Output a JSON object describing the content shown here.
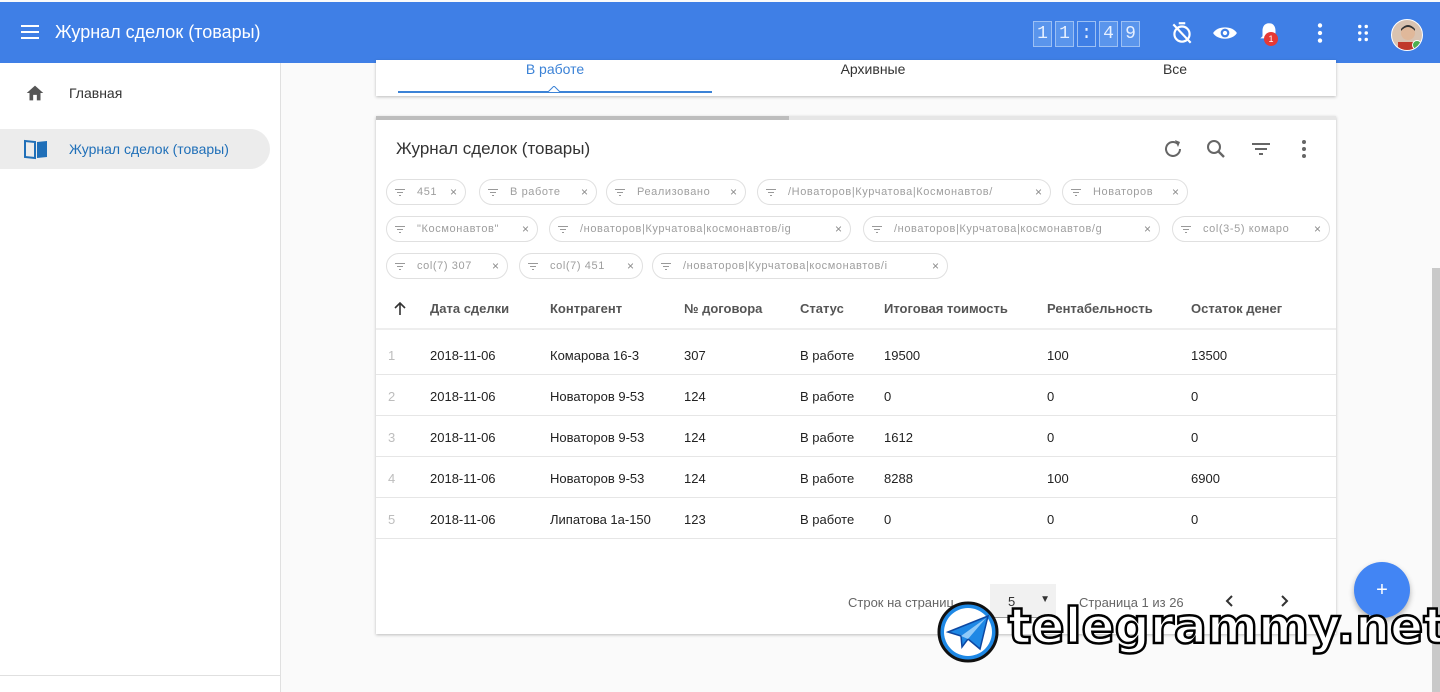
{
  "app": {
    "title": "Журнал сделок (товары)",
    "clock": [
      "1",
      "1",
      ":",
      "4",
      "9"
    ],
    "notifications_count": "1",
    "icons": [
      "menu-icon",
      "timer-off-icon",
      "eye-icon",
      "bell-icon",
      "more-vert-icon",
      "apps-icon"
    ]
  },
  "sidebar": {
    "items": [
      {
        "label": "Главная",
        "icon": "home-icon"
      },
      {
        "label": "Журнал сделок (товары)",
        "icon": "book-icon"
      }
    ]
  },
  "tabs": [
    {
      "label": "В работе"
    },
    {
      "label": "Архивные"
    },
    {
      "label": "Все"
    }
  ],
  "table_card": {
    "title": "Журнал сделок (товары)",
    "progress": 0.43,
    "chips": [
      "451",
      "В работе",
      "Реализовано",
      "/Новаторов|Курчатова|Космонавтов/",
      "Новаторов",
      "\"Космонавтов\"",
      "/новаторов|Курчатова|космонавтов/ig",
      "/новаторов|Курчатова|космонавтов/g",
      "col(3-5) комаро",
      "col(7) 307",
      "col(7) 451",
      "/новаторов|Курчатова|космонавтов/i"
    ],
    "columns": [
      "Дата сделки",
      "Контрагент",
      "№ договора",
      "Статус",
      "Итоговая тоимость",
      "Рентабельность",
      "Остаток денег"
    ],
    "rows": [
      [
        "1",
        "2018-11-06",
        "Комарова 16-3",
        "307",
        "В работе",
        "19500",
        "100",
        "13500"
      ],
      [
        "2",
        "2018-11-06",
        "Новаторов 9-53",
        "124",
        "В работе",
        "0",
        "0",
        "0"
      ],
      [
        "3",
        "2018-11-06",
        "Новаторов 9-53",
        "124",
        "В работе",
        "1612",
        "0",
        "0"
      ],
      [
        "4",
        "2018-11-06",
        "Новаторов 9-53",
        "124",
        "В работе",
        "8288",
        "100",
        "6900"
      ],
      [
        "5",
        "2018-11-06",
        "Липатова 1а-150",
        "123",
        "В работе",
        "0",
        "0",
        "0"
      ]
    ],
    "pager": {
      "rows_per_page_label": "Строк на страниц",
      "rows_per_page": "5",
      "page_info": "Страница 1 из 26"
    }
  },
  "fab_label": "+",
  "watermark": "telegrammy.net",
  "colors": {
    "primary": "#3f7fe6",
    "accent": "#3b82d6",
    "fab": "#4285f4"
  }
}
